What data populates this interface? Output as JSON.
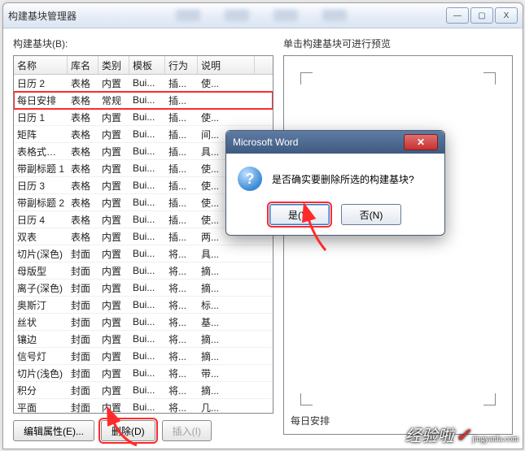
{
  "window": {
    "title": "构建基块管理器",
    "min": "—",
    "max": "▢",
    "close": "X"
  },
  "left_label": "构建基块(B):",
  "columns": [
    "名称",
    "库名",
    "类别",
    "模板",
    "行为",
    "说明"
  ],
  "rows": [
    {
      "c": [
        "日历 2",
        "表格",
        "内置",
        "Bui...",
        "插...",
        "使..."
      ],
      "sel": false
    },
    {
      "c": [
        "每日安排",
        "表格",
        "常规",
        "Bui...",
        "插...",
        ""
      ],
      "sel": true
    },
    {
      "c": [
        "日历 1",
        "表格",
        "内置",
        "Bui...",
        "插...",
        "使..."
      ],
      "sel": false
    },
    {
      "c": [
        "矩阵",
        "表格",
        "内置",
        "Bui...",
        "插...",
        "间..."
      ],
      "sel": false
    },
    {
      "c": [
        "表格式列表",
        "表格",
        "内置",
        "Bui...",
        "插...",
        "具..."
      ],
      "sel": false
    },
    {
      "c": [
        "带副标题 1",
        "表格",
        "内置",
        "Bui...",
        "插...",
        "使..."
      ],
      "sel": false
    },
    {
      "c": [
        "日历 3",
        "表格",
        "内置",
        "Bui...",
        "插...",
        "使..."
      ],
      "sel": false
    },
    {
      "c": [
        "带副标题 2",
        "表格",
        "内置",
        "Bui...",
        "插...",
        "使..."
      ],
      "sel": false
    },
    {
      "c": [
        "日历 4",
        "表格",
        "内置",
        "Bui...",
        "插...",
        "使..."
      ],
      "sel": false
    },
    {
      "c": [
        "双表",
        "表格",
        "内置",
        "Bui...",
        "插...",
        "两..."
      ],
      "sel": false
    },
    {
      "c": [
        "切片(深色)",
        "封面",
        "内置",
        "Bui...",
        "将...",
        "具..."
      ],
      "sel": false
    },
    {
      "c": [
        "母版型",
        "封面",
        "内置",
        "Bui...",
        "将...",
        "摘..."
      ],
      "sel": false
    },
    {
      "c": [
        "离子(深色)",
        "封面",
        "内置",
        "Bui...",
        "将...",
        "摘..."
      ],
      "sel": false
    },
    {
      "c": [
        "奥斯汀",
        "封面",
        "内置",
        "Bui...",
        "将...",
        "标..."
      ],
      "sel": false
    },
    {
      "c": [
        "丝状",
        "封面",
        "内置",
        "Bui...",
        "将...",
        "基..."
      ],
      "sel": false
    },
    {
      "c": [
        "镶边",
        "封面",
        "内置",
        "Bui...",
        "将...",
        "摘..."
      ],
      "sel": false
    },
    {
      "c": [
        "信号灯",
        "封面",
        "内置",
        "Bui...",
        "将...",
        "摘..."
      ],
      "sel": false
    },
    {
      "c": [
        "切片(浅色)",
        "封面",
        "内置",
        "Bui...",
        "将...",
        "带..."
      ],
      "sel": false
    },
    {
      "c": [
        "积分",
        "封面",
        "内置",
        "Bui...",
        "将...",
        "摘..."
      ],
      "sel": false
    },
    {
      "c": [
        "平面",
        "封面",
        "内置",
        "Bui...",
        "将...",
        "几..."
      ],
      "sel": false
    }
  ],
  "buttons": {
    "edit": "编辑属性(E)...",
    "delete": "删除(D)",
    "insert": "插入(I)"
  },
  "right_label": "单击构建基块可进行预览",
  "preview_name": "每日安排",
  "dialog": {
    "title": "Microsoft Word",
    "message": "是否确实要删除所选的构建基块?",
    "yes": "是(Y)",
    "no": "否(N)",
    "q": "?"
  },
  "watermark": {
    "main": "经验啦",
    "sub": "jingyanla.com"
  }
}
